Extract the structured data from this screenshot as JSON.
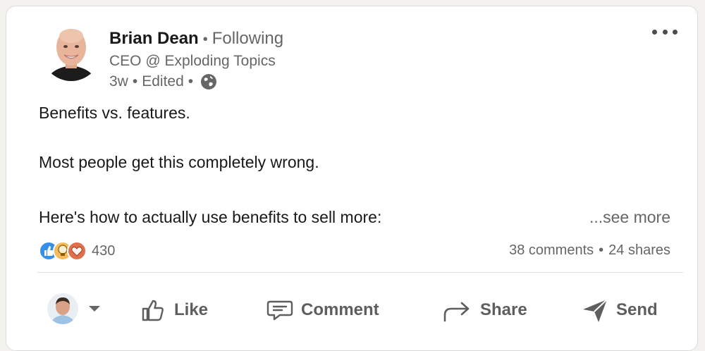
{
  "post": {
    "author": {
      "name": "Brian Dean",
      "follow_status": "Following",
      "headline": "CEO @ Exploding Topics",
      "time": "3w",
      "edited": "Edited",
      "visibility_icon": "globe-icon"
    },
    "menu_icon": "more-icon",
    "text_lines": [
      "Benefits vs. features.",
      "Most people get this completely wrong.",
      "Here's how to actually use benefits to sell more:"
    ],
    "see_more": "...see more",
    "social": {
      "reaction_icons": [
        "like-reaction-icon",
        "insightful-reaction-icon",
        "love-reaction-icon"
      ],
      "reaction_count": "430",
      "comments": "38 comments",
      "shares": "24 shares"
    },
    "actions": {
      "like": "Like",
      "comment": "Comment",
      "share": "Share",
      "send": "Send"
    }
  },
  "colors": {
    "text_primary": "#191919",
    "text_secondary": "#666666",
    "action_text": "#5e5e5e",
    "like_blue": "#378fe9",
    "insightful_yellow": "#f5bb5c",
    "love_red": "#df704d",
    "divider": "#e0e0e0"
  }
}
